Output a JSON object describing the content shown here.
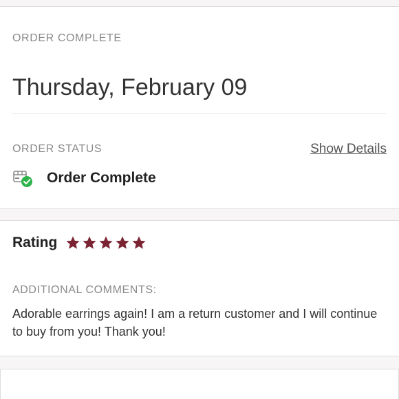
{
  "order": {
    "eyebrow": "ORDER COMPLETE",
    "date": "Thursday, February 09",
    "status_eyebrow": "ORDER STATUS",
    "show_details_label": "Show Details",
    "status_label": "Order Complete",
    "status_icon": "package-check-icon"
  },
  "rating": {
    "label": "Rating",
    "stars": 5,
    "max_stars": 5,
    "star_color": "#7a2433",
    "comments_eyebrow": "ADDITIONAL COMMENTS:",
    "comment": "Adorable earrings again! I am a return customer and I will continue to buy from you! Thank you!"
  },
  "colors": {
    "success": "#2db34a",
    "muted_text": "#8a8a8a"
  }
}
